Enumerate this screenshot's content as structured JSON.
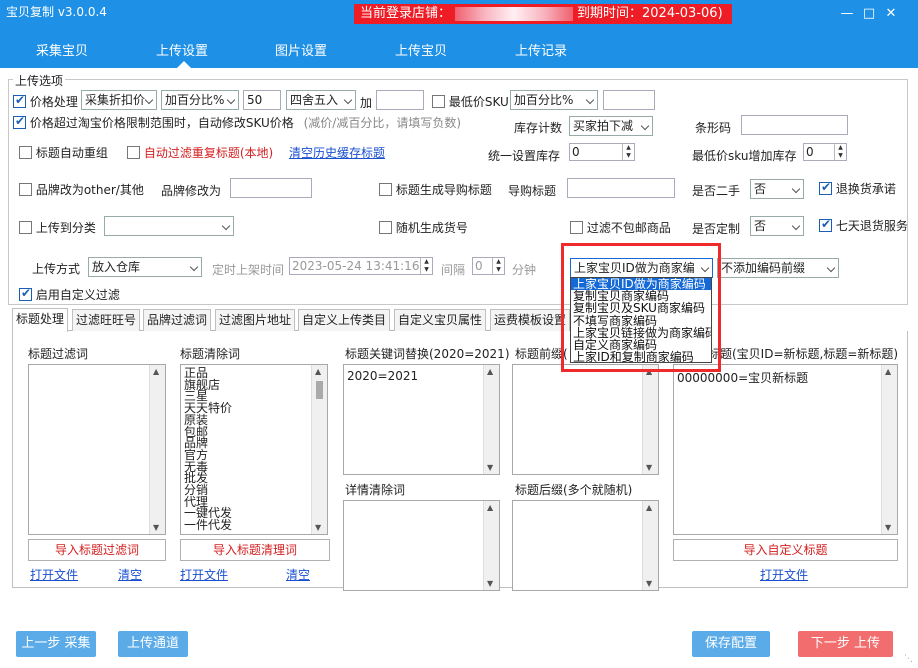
{
  "app": {
    "title": "宝贝复制 v3.0.0.4",
    "banner_prefix": "当前登录店铺：",
    "banner_expiry": "到期时间：2024-03-06)",
    "nav": [
      "采集宝贝",
      "上传设置",
      "图片设置",
      "上传宝贝",
      "上传记录"
    ],
    "active_nav": "上传设置"
  },
  "upload_options": {
    "group_title": "上传选项",
    "price_process": {
      "label": "价格处理",
      "checked": true,
      "mode": "采集折扣价",
      "op": "加百分比%",
      "value": "50",
      "rounding": "四舍五入",
      "add_label": "加",
      "add_value": ""
    },
    "min_sku": {
      "label": "最低价SKU",
      "checked": false,
      "op": "加百分比%",
      "value": ""
    },
    "price_limit": {
      "label": "价格超过淘宝价格限制范围时，自动修改SKU价格",
      "hint": "(减价/减百分比，请填写负数)",
      "checked": true
    },
    "stock_count": {
      "label": "库存计数",
      "value": "买家拍下减"
    },
    "barcode": {
      "label": "条形码",
      "value": ""
    },
    "auto_regroup": {
      "label": "标题自动重组",
      "checked": false
    },
    "auto_filter_dup": {
      "label": "自动过滤重复标题(本地)",
      "checked": false
    },
    "clear_cache_link": "清空历史缓存标题",
    "unified_stock": {
      "label": "统一设置库存",
      "value": "0"
    },
    "min_sku_stock": {
      "label": "最低价sku增加库存",
      "value": "0"
    },
    "brand_other": {
      "label": "品牌改为other/其他",
      "checked": false
    },
    "brand_change": {
      "label": "品牌修改为",
      "value": ""
    },
    "gen_guide_title": {
      "label": "标题生成导购标题",
      "checked": false
    },
    "guide_title": {
      "label": "导购标题",
      "value": ""
    },
    "second_hand": {
      "label": "是否二手",
      "value": "否"
    },
    "return_promise": {
      "label": "退换货承诺",
      "checked": true
    },
    "upload_category": {
      "label": "上传到分类",
      "checked": false,
      "value": ""
    },
    "random_item_no": {
      "label": "随机生成货号",
      "checked": false
    },
    "filter_no_free_ship": {
      "label": "过滤不包邮商品",
      "checked": false
    },
    "customized": {
      "label": "是否定制",
      "value": "否"
    },
    "seven_day_return": {
      "label": "七天退货服务",
      "checked": true
    },
    "upload_method": {
      "label": "上传方式",
      "value": "放入仓库"
    },
    "scheduled": {
      "label": "定时上架时间",
      "value": "2023-05-24 13:41:16",
      "interval_label": "间隔",
      "interval_value": "0",
      "unit": "分钟"
    },
    "merchant_code": {
      "value": "上家宝贝ID做为商家编"
    },
    "code_prefix": {
      "value": "不添加编码前缀"
    },
    "custom_filter": {
      "label": "启用自定义过滤",
      "checked": true
    }
  },
  "merchant_code_options": [
    "上家宝贝ID做为商家编码",
    "复制宝贝商家编码",
    "复制宝贝及SKU商家编码",
    "不填写商家编码",
    "上家宝贝链接做为商家编码",
    "自定义商家编码",
    "上家ID和复制商家编码"
  ],
  "tabs": [
    "标题处理",
    "过滤旺旺号",
    "品牌过滤词",
    "过滤图片地址",
    "自定义上传类目",
    "自定义宝贝属性",
    "运费模板设置"
  ],
  "title_panel": {
    "filter_words": {
      "label": "标题过滤词",
      "import_btn": "导入标题过滤词",
      "open_link": "打开文件",
      "clear_link": "清空"
    },
    "clear_words": {
      "label": "标题清除词",
      "items": [
        "正品",
        "旗舰店",
        "三星",
        "天天特价",
        "原装",
        "包邮",
        "品牌",
        "官方",
        "无毒",
        "批发",
        "分销",
        "代理",
        "一键代发",
        "一件代发"
      ],
      "import_btn": "导入标题清理词",
      "open_link": "打开文件",
      "clear_link": "清空"
    },
    "keyword_replace": {
      "label": "标题关键词替换(2020=2021)",
      "content": "2020=2021"
    },
    "detail_clear": {
      "label": "详情清除词"
    },
    "prefix": {
      "label": "标题前缀("
    },
    "suffix": {
      "label": "标题后缀(多个就随机)"
    },
    "custom_title": {
      "label": "标题(宝贝ID=新标题,标题=新标题)",
      "content": "00000000=宝贝新标题",
      "import_btn": "导入自定义标题",
      "open_link": "打开文件"
    }
  },
  "footer": {
    "prev": "上一步 采集",
    "channel": "上传通道",
    "save": "保存配置",
    "next": "下一步 上传"
  },
  "colors": {
    "header": "#1e90e6",
    "banner": "#ee1c24",
    "highlight": "#1469d6",
    "next_btn": "#f26d6d",
    "blue_btn": "#5aabe8"
  }
}
